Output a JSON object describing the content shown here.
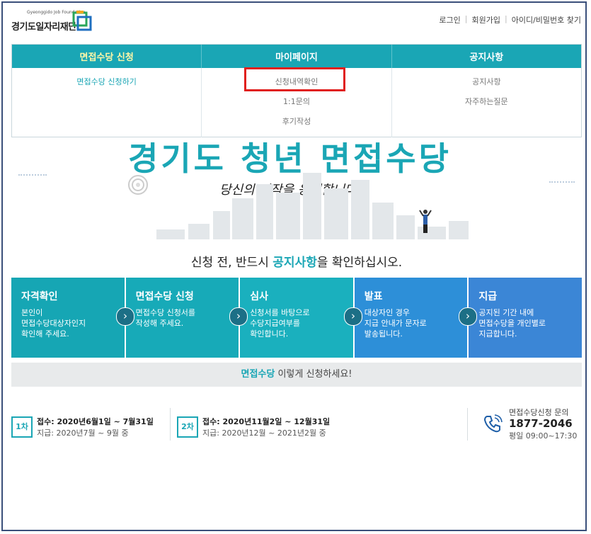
{
  "header": {
    "logo_small": "Gyeonggido Job Foundation",
    "logo_main": "경기도일자리재단",
    "links": [
      "로그인",
      "회원가입",
      "아이디/비밀번호 찾기"
    ]
  },
  "nav": {
    "menus": [
      {
        "label": "면접수당 신청",
        "items": [
          "면접수당 신청하기"
        ]
      },
      {
        "label": "마이페이지",
        "items": [
          "신청내역확인",
          "1:1문의",
          "후기작성"
        ]
      },
      {
        "label": "공지사항",
        "items": [
          "공지사항",
          "자주하는질문"
        ]
      }
    ]
  },
  "hero": {
    "title": "경기도 청년 면접수당",
    "subtitle": "당신의 시작을 응원합니다.",
    "notice_pre": "신청 전, 반드시 ",
    "notice_link": "공지사항",
    "notice_post": "을 확인하십시오."
  },
  "steps": [
    {
      "title": "자격확인",
      "desc": "본인이\n면접수당대상자인지\n확인해 주세요."
    },
    {
      "title": "면접수당 신청",
      "desc": "면접수당 신청서를\n작성해 주세요."
    },
    {
      "title": "심사",
      "desc": "신청서를 바탕으로\n수당지급여부를\n확인합니다."
    },
    {
      "title": "발표",
      "desc": "대상자인 경우\n지급 안내가 문자로\n발송됩니다."
    },
    {
      "title": "지급",
      "desc": "공지된 기간 내에\n면접수당을 개인별로\n지급합니다."
    }
  ],
  "how_to": {
    "highlight": "면접수당",
    "text": " 이렇게 신청하세요!"
  },
  "schedule": [
    {
      "badge": "1차",
      "line1": "접수: 2020년6월1일 ~ 7월31일",
      "line2": "지급: 2020년7월 ~ 9월 중"
    },
    {
      "badge": "2차",
      "line1": "접수: 2020년11월2일 ~ 12월31일",
      "line2": "지급: 2020년12월 ~ 2021년2월 중"
    }
  ],
  "contact": {
    "label": "면접수당신청 문의",
    "phone": "1877-2046",
    "hours": "평일 09:00~17:30"
  },
  "colors": {
    "primary": "#1aa6b5",
    "blue": "#2d8fd8",
    "highlight_box": "#e0201e"
  }
}
